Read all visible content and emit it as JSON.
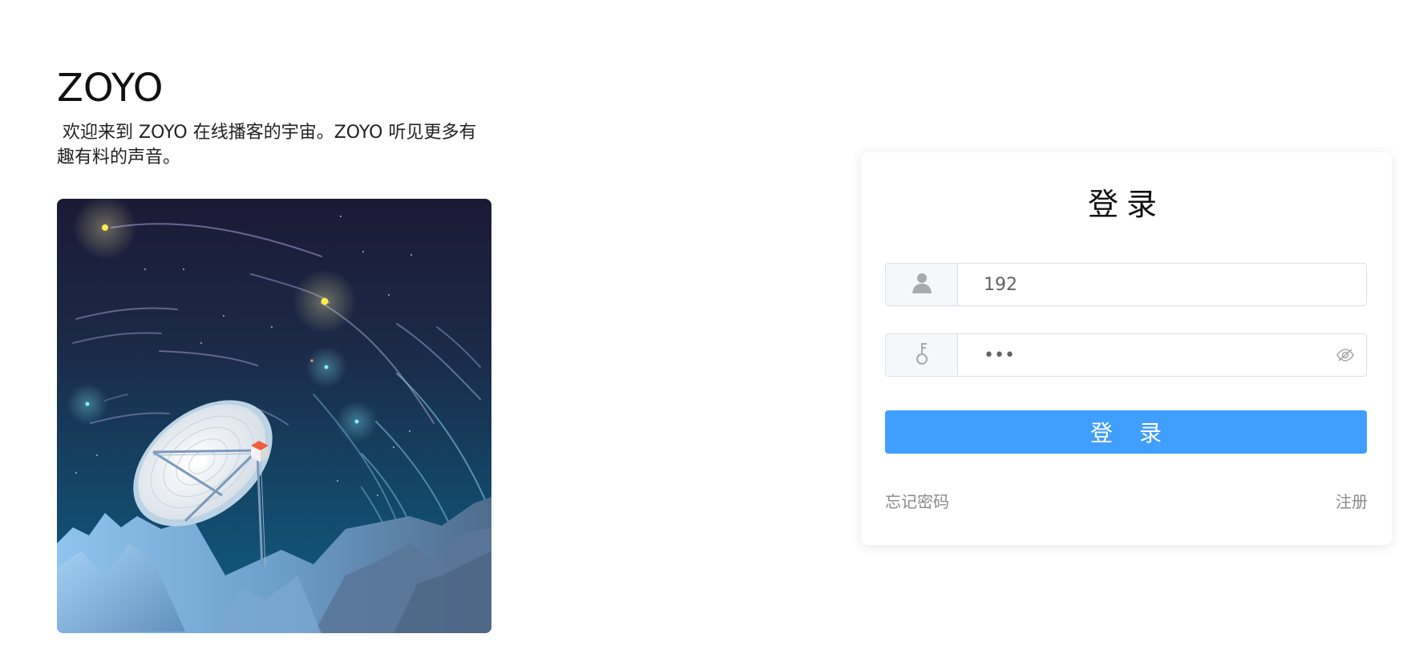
{
  "brand": {
    "title": "ZOYO",
    "description": " 欢迎来到 ZOYO 在线播客的宇宙。ZOYO 听见更多有趣有料的声音。"
  },
  "login": {
    "title": "登录",
    "username": {
      "value": "192",
      "icon": "user-icon"
    },
    "password": {
      "value": "•••",
      "icon": "key-icon",
      "toggle_icon": "eye-off-icon"
    },
    "submit_label": "登 录",
    "forgot_label": "忘记密码",
    "register_label": "注册"
  },
  "colors": {
    "primary": "#409eff",
    "prefix_bg": "#f5f7fa",
    "border": "#dcdfe6",
    "link": "#8a8a8a"
  }
}
